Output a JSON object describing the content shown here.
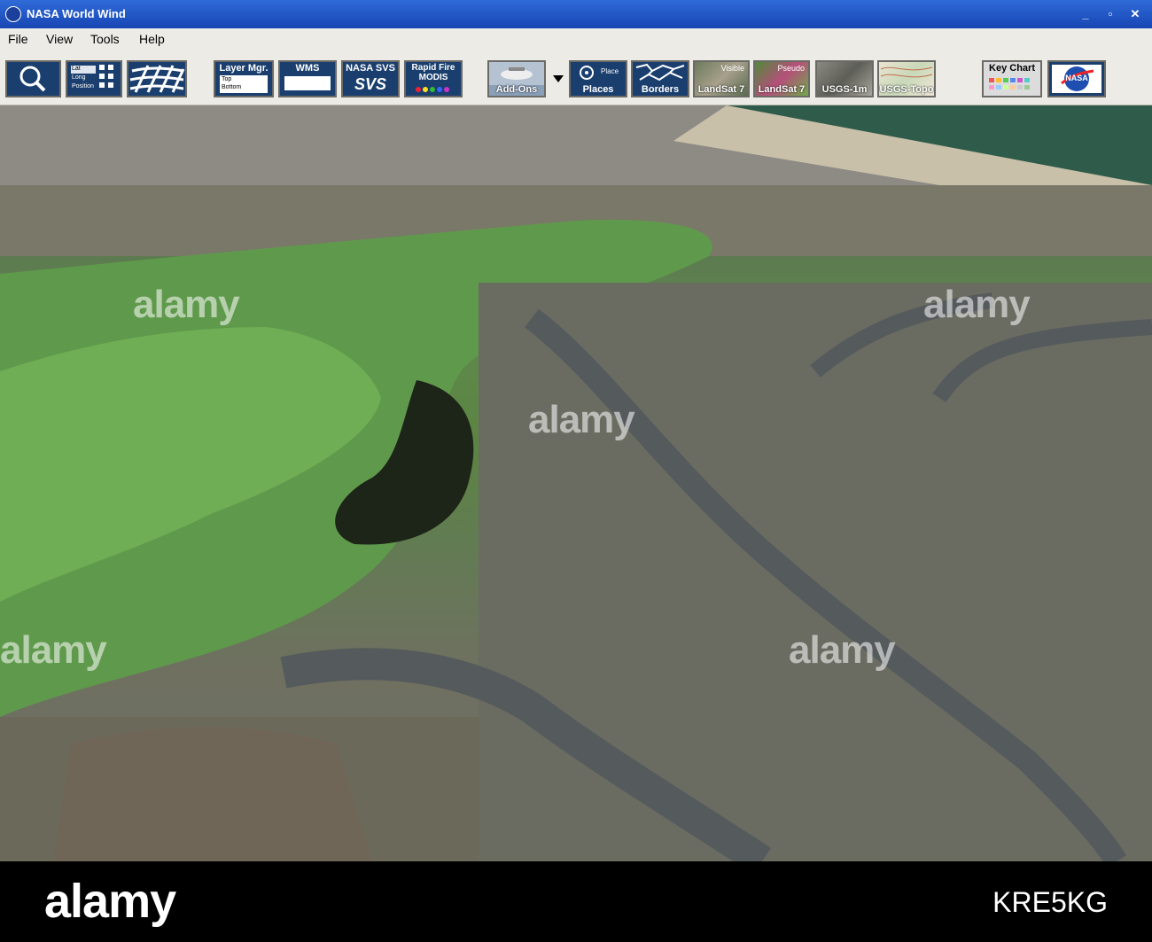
{
  "window": {
    "title": "NASA World Wind",
    "controls": [
      "_",
      "▫",
      "✕"
    ]
  },
  "menu": [
    "File",
    "View",
    "Tools",
    "Help"
  ],
  "toolbar": {
    "search": "",
    "latlong": {
      "lat": "Lat",
      "long": "Long",
      "position": "Position"
    },
    "layer_mgr": {
      "label": "Layer Mgr.",
      "top": "Top",
      "bottom": "Bottom"
    },
    "wms": "WMS",
    "nasa_svs": {
      "label": "NASA SVS",
      "logo": "SVS"
    },
    "rapid_fire": {
      "line1": "Rapid Fire",
      "line2": "MODIS"
    },
    "addons": "Add-Ons",
    "places": {
      "label": "Places",
      "sub": "Place"
    },
    "borders": "Borders",
    "landsat_visible": {
      "label": "LandSat 7",
      "sub": "Visible"
    },
    "landsat_pseudo": {
      "label": "LandSat 7",
      "sub": "Pseudo"
    },
    "usgs_1m": "USGS-1m",
    "usgs_topo": "USGS-Topo",
    "key_chart": "Key Chart",
    "nasa_logo": "NASA"
  },
  "watermark": {
    "word": "alamy",
    "image_id": "KRE5KG"
  },
  "colors": {
    "titlebar": "#2f6bd8",
    "toolbar_bg": "#ecebe6",
    "button_navy": "#1a3f6e",
    "map_green": "#5f8a4c"
  }
}
